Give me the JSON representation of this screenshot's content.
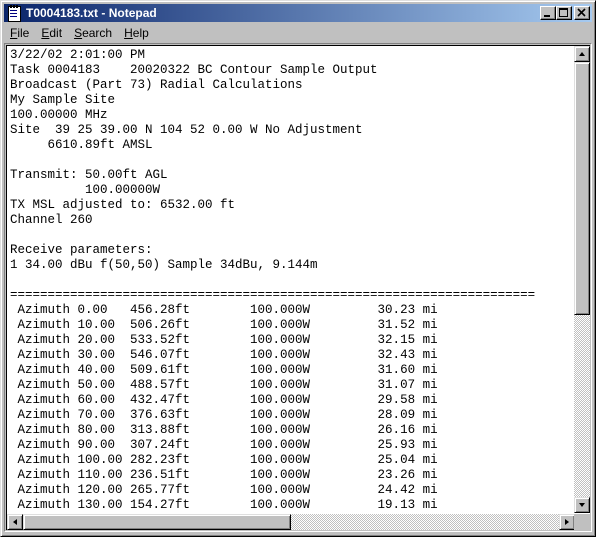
{
  "window": {
    "title": "T0004183.txt - Notepad",
    "icon": "notepad-icon"
  },
  "menu": {
    "items": [
      {
        "label": "File",
        "accel": "F",
        "rest": "ile"
      },
      {
        "label": "Edit",
        "accel": "E",
        "rest": "dit"
      },
      {
        "label": "Search",
        "accel": "S",
        "rest": "earch"
      },
      {
        "label": "Help",
        "accel": "H",
        "rest": "elp"
      }
    ]
  },
  "document": {
    "lines": [
      "3/22/02 2:01:00 PM",
      "Task 0004183    20020322 BC Contour Sample Output",
      "Broadcast (Part 73) Radial Calculations",
      "My Sample Site",
      "100.00000 MHz",
      "Site  39 25 39.00 N 104 52 0.00 W No Adjustment",
      "     6610.89ft AMSL",
      "",
      "Transmit: 50.00ft AGL",
      "          100.00000W",
      "TX MSL adjusted to: 6532.00 ft",
      "Channel 260",
      "",
      "Receive parameters:",
      "1 34.00 dBu f(50,50) Sample 34dBu, 9.144m",
      "",
      "======================================================================",
      " Azimuth 0.00   456.28ft        100.000W         30.23 mi",
      " Azimuth 10.00  506.26ft        100.000W         31.52 mi",
      " Azimuth 20.00  533.52ft        100.000W         32.15 mi",
      " Azimuth 30.00  546.07ft        100.000W         32.43 mi",
      " Azimuth 40.00  509.61ft        100.000W         31.60 mi",
      " Azimuth 50.00  488.57ft        100.000W         31.07 mi",
      " Azimuth 60.00  432.47ft        100.000W         29.58 mi",
      " Azimuth 70.00  376.63ft        100.000W         28.09 mi",
      " Azimuth 80.00  313.88ft        100.000W         26.16 mi",
      " Azimuth 90.00  307.24ft        100.000W         25.93 mi",
      " Azimuth 100.00 282.23ft        100.000W         25.04 mi",
      " Azimuth 110.00 236.51ft        100.000W         23.26 mi",
      " Azimuth 120.00 265.77ft        100.000W         24.42 mi",
      " Azimuth 130.00 154.27ft        100.000W         19.13 mi"
    ]
  }
}
